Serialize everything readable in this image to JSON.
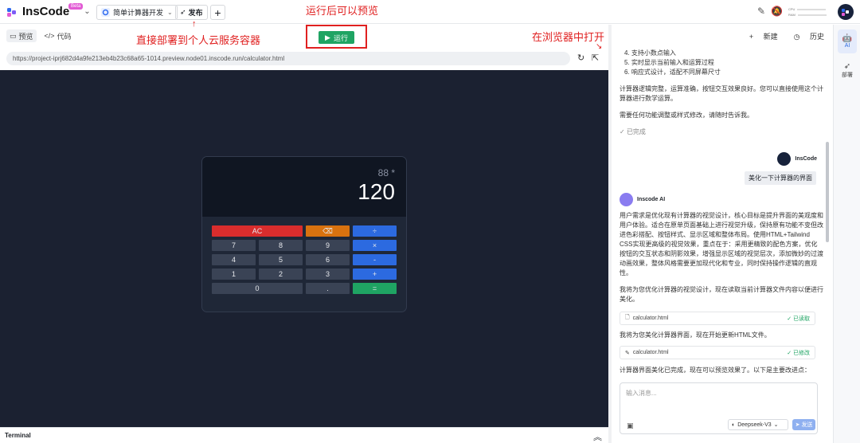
{
  "topbar": {
    "logo_text": "InsCode",
    "beta": "Beta",
    "project_name": "简单计算器开发",
    "publish_label": "发布",
    "meter_cpu": "CPU",
    "meter_ram": "RAM"
  },
  "annotations": {
    "run_preview": "运行后可以预览",
    "deploy": "直接部署到个人云服务容器",
    "open_browser": "在浏览器中打开"
  },
  "left": {
    "tab_preview": "预览",
    "tab_code": "代码",
    "run_label": "运行",
    "url": "https://project-iprj682d4a9fe213eb4b23c68a65-1014.preview.node01.inscode.run/calculator.html",
    "terminal_label": "Terminal"
  },
  "calculator": {
    "previous": "88 *",
    "current": "120",
    "rows": [
      [
        {
          "label": "AC",
          "color": "#d92d2d",
          "span": 2
        },
        {
          "label": "⌫",
          "color": "#d8720f",
          "span": 1
        },
        {
          "label": "÷",
          "color": "#2c6ae0",
          "span": 1
        }
      ],
      [
        {
          "label": "7",
          "color": "#3a4355",
          "span": 1
        },
        {
          "label": "8",
          "color": "#3a4355",
          "span": 1
        },
        {
          "label": "9",
          "color": "#3a4355",
          "span": 1
        },
        {
          "label": "×",
          "color": "#2c6ae0",
          "span": 1
        }
      ],
      [
        {
          "label": "4",
          "color": "#3a4355",
          "span": 1
        },
        {
          "label": "5",
          "color": "#3a4355",
          "span": 1
        },
        {
          "label": "6",
          "color": "#3a4355",
          "span": 1
        },
        {
          "label": "-",
          "color": "#2c6ae0",
          "span": 1
        }
      ],
      [
        {
          "label": "1",
          "color": "#3a4355",
          "span": 1
        },
        {
          "label": "2",
          "color": "#3a4355",
          "span": 1
        },
        {
          "label": "3",
          "color": "#3a4355",
          "span": 1
        },
        {
          "label": "+",
          "color": "#2c6ae0",
          "span": 1
        }
      ],
      [
        {
          "label": "0",
          "color": "#3a4355",
          "span": 2
        },
        {
          "label": ".",
          "color": "#3a4355",
          "span": 1
        },
        {
          "label": "=",
          "color": "#1fa463",
          "span": 1
        }
      ]
    ]
  },
  "ai_panel": {
    "new_label": "新建",
    "history_label": "历史",
    "list_items": [
      "4. 支持小数点输入",
      "5. 实时显示当前输入和运算过程",
      "6. 响应式设计，适配不同屏幕尺寸"
    ],
    "summary_text": "计算器逻辑完整，运算准确，按钮交互效果良好。您可以直接使用这个计算器进行数学运算。",
    "followup_text": "需要任何功能调整或样式修改，请随时告诉我。",
    "done_label": "已完成",
    "user_name": "InsCode",
    "user_message": "美化一下计算器的界面",
    "bot_name": "Inscode AI",
    "bot_reply": "用户需求是优化现有计算器的视觉设计，核心目标是提升界面的美观度和用户体验。适合在原单页面基础上进行视觉升级，保持原有功能不变但改进色彩搭配、按钮样式、显示区域和整体布局。使用HTML+Tailwind CSS实现更高级的视觉效果，重点在于：采用更精致的配色方案，优化按钮的交互状态和阴影效果，增强显示区域的视觉层次，添加微妙的过渡动画效果，整体风格需要更加现代化和专业，同时保持操作逻辑的直观性。",
    "read_intro": "我将为您优化计算器的视觉设计，现在读取当前计算器文件内容以便进行美化。",
    "file1_name": "calculator.html",
    "file1_status": "已读取",
    "update_intro": "我将为您美化计算器界面，现在开始更新HTML文件。",
    "file2_name": "calculator.html",
    "file2_status": "已修改",
    "final_text": "计算器界面美化已完成，现在可以预览效果了。以下是主要改进点：",
    "input_placeholder": "输入消息...",
    "model_name": "Deepseek-V3",
    "send_label": "发送"
  },
  "rail": {
    "ai_label": "AI",
    "deploy_label": "部署"
  }
}
